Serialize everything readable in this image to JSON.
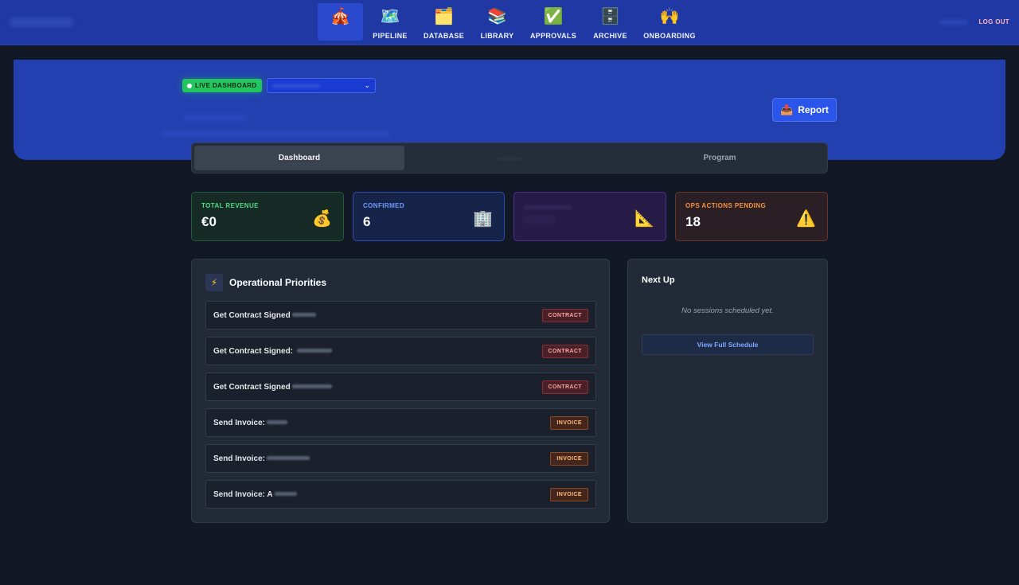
{
  "nav": {
    "items": [
      {
        "label": "",
        "icon": "circus-tent-icon",
        "glyph": "🎪",
        "active": true
      },
      {
        "label": "PIPELINE",
        "icon": "map-icon",
        "glyph": "🗺️"
      },
      {
        "label": "DATABASE",
        "icon": "folder-icon",
        "glyph": "🗂️"
      },
      {
        "label": "LIBRARY",
        "icon": "books-icon",
        "glyph": "📚"
      },
      {
        "label": "APPROVALS",
        "icon": "approval-icon",
        "glyph": "✅"
      },
      {
        "label": "ARCHIVE",
        "icon": "archive-icon",
        "glyph": "🗄️"
      },
      {
        "label": "ONBOARDING",
        "icon": "onboarding-icon",
        "glyph": "🙌"
      }
    ],
    "logout_label": "LOG OUT"
  },
  "hero": {
    "live_badge": "LIVE DASHBOARD",
    "report_label": "Report",
    "report_icon": "📤"
  },
  "tabs": [
    "Dashboard",
    "",
    "Program"
  ],
  "stats": {
    "revenue": {
      "label": "TOTAL REVENUE",
      "value": "€0",
      "icon": "💰"
    },
    "confirmed": {
      "label": "CONFIRMED",
      "value": "6",
      "icon": "🏢"
    },
    "third": {
      "icon": "📐"
    },
    "ops": {
      "label": "OPS ACTIONS PENDING",
      "value": "18",
      "icon": "⚠️"
    }
  },
  "priorities": {
    "title": "Operational Priorities",
    "icon": "⚡",
    "tasks": [
      {
        "text": "Get Contract Signed",
        "tag": "CONTRACT",
        "type": "contract"
      },
      {
        "text": "Get Contract Signed: ",
        "tag": "CONTRACT",
        "type": "contract"
      },
      {
        "text": "Get Contract Signed",
        "tag": "CONTRACT",
        "type": "contract"
      },
      {
        "text": "Send Invoice:",
        "tag": "INVOICE",
        "type": "invoice"
      },
      {
        "text": "Send Invoice:",
        "tag": "INVOICE",
        "type": "invoice"
      },
      {
        "text": "Send Invoice: A",
        "tag": "INVOICE",
        "type": "invoice"
      }
    ]
  },
  "nextup": {
    "title": "Next Up",
    "empty_text": "No sessions scheduled yet.",
    "button_label": "View Full Schedule"
  }
}
